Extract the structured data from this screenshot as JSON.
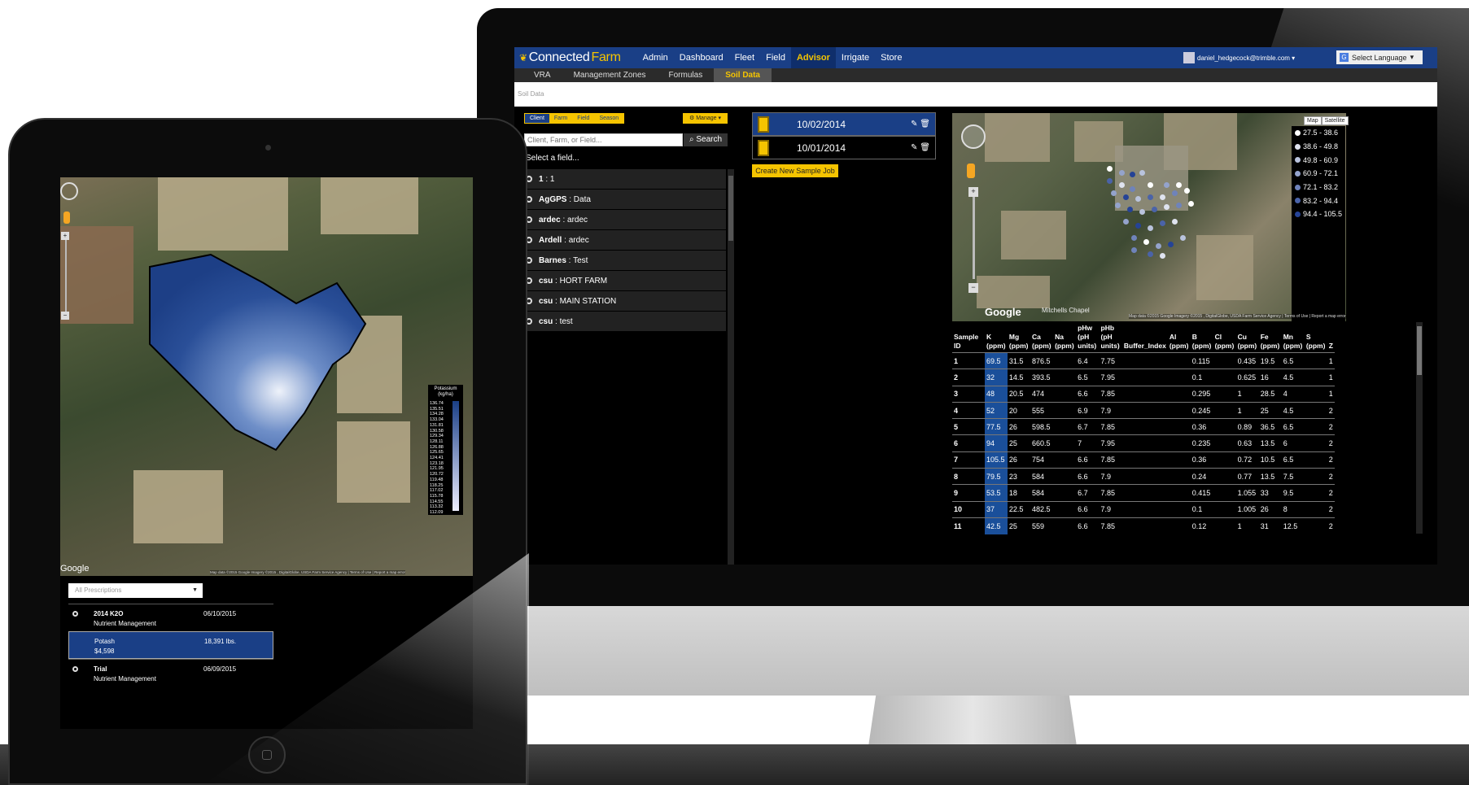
{
  "app": {
    "brand_connected": "Connected",
    "brand_farm": "Farm",
    "nav": [
      "Admin",
      "Dashboard",
      "Fleet",
      "Field",
      "Advisor",
      "Irrigate",
      "Store"
    ],
    "nav_active": "Advisor",
    "user": "daniel_hedgecock@trimble.com ▾",
    "language": "Select Language",
    "subnav": [
      "VRA",
      "Management Zones",
      "Formulas",
      "Soil Data"
    ],
    "subnav_active": "Soil Data",
    "breadcrumb": "Soil Data"
  },
  "left": {
    "filter_tabs": [
      "Client",
      "Farm",
      "Field",
      "Season"
    ],
    "manage_label": "⚙ Manage ▾",
    "search_placeholder": "Client, Farm, or Field...",
    "search_label": "Search",
    "select_label": "Select a field...",
    "fields": [
      {
        "name": "1",
        "sub": "1"
      },
      {
        "name": "AgGPS",
        "sub": "Data"
      },
      {
        "name": "ardec",
        "sub": "ardec"
      },
      {
        "name": "Ardell",
        "sub": "ardec"
      },
      {
        "name": "Barnes",
        "sub": "Test"
      },
      {
        "name": "csu",
        "sub": "HORT FARM"
      },
      {
        "name": "csu",
        "sub": "MAIN STATION"
      },
      {
        "name": "csu",
        "sub": "test"
      }
    ]
  },
  "jobs": {
    "items": [
      {
        "date": "10/02/2014"
      },
      {
        "date": "10/01/2014"
      }
    ],
    "new_label": "Create New Sample Job"
  },
  "map": {
    "type_map": "Map",
    "type_satellite": "Satellite",
    "legend": [
      {
        "label": "27.5 - 38.6",
        "color": "#ffffff"
      },
      {
        "label": "38.6 - 49.8",
        "color": "#dfe3ef"
      },
      {
        "label": "49.8 - 60.9",
        "color": "#b9c3dd"
      },
      {
        "label": "60.9 - 72.1",
        "color": "#94a3cc"
      },
      {
        "label": "72.1 - 83.2",
        "color": "#6f83ba"
      },
      {
        "label": "83.2 - 94.4",
        "color": "#4a63a8"
      },
      {
        "label": "94.4 - 105.5",
        "color": "#254396"
      }
    ],
    "google": "Google",
    "place": "Mitchells Chapel",
    "attribution": "Map data ©2015 Google Imagery ©2015 , DigitalGlobe, USDA Farm Service Agency | Terms of Use | Report a map error"
  },
  "table": {
    "headers": [
      "Sample ID",
      "K (ppm)",
      "Mg (ppm)",
      "Ca (ppm)",
      "Na (ppm)",
      "pHw (pH units)",
      "pHb (pH units)",
      "Buffer_Index",
      "Al (ppm)",
      "B (ppm)",
      "Cl (ppm)",
      "Cu (ppm)",
      "Fe (ppm)",
      "Mn (ppm)",
      "S (ppm)",
      "Z"
    ],
    "rows": [
      [
        "1",
        "69.5",
        "31.5",
        "876.5",
        "",
        "6.4",
        "7.75",
        "",
        "",
        "0.115",
        "",
        "0.435",
        "19.5",
        "6.5",
        "",
        "1"
      ],
      [
        "2",
        "32",
        "14.5",
        "393.5",
        "",
        "6.5",
        "7.95",
        "",
        "",
        "0.1",
        "",
        "0.625",
        "16",
        "4.5",
        "",
        "1"
      ],
      [
        "3",
        "48",
        "20.5",
        "474",
        "",
        "6.6",
        "7.85",
        "",
        "",
        "0.295",
        "",
        "1",
        "28.5",
        "4",
        "",
        "1"
      ],
      [
        "4",
        "52",
        "20",
        "555",
        "",
        "6.9",
        "7.9",
        "",
        "",
        "0.245",
        "",
        "1",
        "25",
        "4.5",
        "",
        "2"
      ],
      [
        "5",
        "77.5",
        "26",
        "598.5",
        "",
        "6.7",
        "7.85",
        "",
        "",
        "0.36",
        "",
        "0.89",
        "36.5",
        "6.5",
        "",
        "2"
      ],
      [
        "6",
        "94",
        "25",
        "660.5",
        "",
        "7",
        "7.95",
        "",
        "",
        "0.235",
        "",
        "0.63",
        "13.5",
        "6",
        "",
        "2"
      ],
      [
        "7",
        "105.5",
        "26",
        "754",
        "",
        "6.6",
        "7.85",
        "",
        "",
        "0.36",
        "",
        "0.72",
        "10.5",
        "6.5",
        "",
        "2"
      ],
      [
        "8",
        "79.5",
        "23",
        "584",
        "",
        "6.6",
        "7.9",
        "",
        "",
        "0.24",
        "",
        "0.77",
        "13.5",
        "7.5",
        "",
        "2"
      ],
      [
        "9",
        "53.5",
        "18",
        "584",
        "",
        "6.7",
        "7.85",
        "",
        "",
        "0.415",
        "",
        "1.055",
        "33",
        "9.5",
        "",
        "2"
      ],
      [
        "10",
        "37",
        "22.5",
        "482.5",
        "",
        "6.6",
        "7.9",
        "",
        "",
        "0.1",
        "",
        "1.005",
        "26",
        "8",
        "",
        "2"
      ],
      [
        "11",
        "42.5",
        "25",
        "559",
        "",
        "6.6",
        "7.85",
        "",
        "",
        "0.12",
        "",
        "1",
        "31",
        "12.5",
        "",
        "2"
      ]
    ]
  },
  "tablet": {
    "legend_title": "Potassium (kg/ha)",
    "legend_ticks": [
      "136.74",
      "135.51",
      "134.28",
      "133.04",
      "131.81",
      "130.58",
      "129.34",
      "128.11",
      "126.88",
      "125.65",
      "124.41",
      "123.18",
      "121.95",
      "120.72",
      "119.48",
      "118.25",
      "117.02",
      "115.78",
      "114.55",
      "113.32",
      "112.09"
    ],
    "google": "Google",
    "attribution": "Map data ©2015 Google Imagery ©2015 , DigitalGlobe, USDA Farm Service Agency | Terms of Use | Report a map error",
    "select_value": "All Prescriptions",
    "prescriptions": [
      {
        "name": "2014 K2O",
        "sub": "Nutrient Management",
        "date": "06/10/2015"
      },
      {
        "name": "Potash",
        "sub": "$4,598",
        "date": "18,391 lbs."
      },
      {
        "name": "Trial",
        "sub": "Nutrient Management",
        "date": "06/09/2015"
      }
    ]
  }
}
